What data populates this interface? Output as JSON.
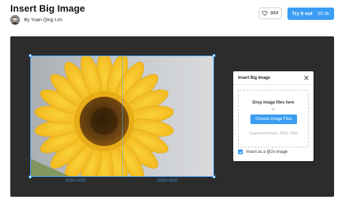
{
  "header": {
    "title": "Insert Big Image",
    "author": "By Yuan Qing Lim",
    "like_count": "884",
    "try_label": "Try it out",
    "try_count": "65.8k"
  },
  "canvas": {
    "dim_left": "3000×4000",
    "dim_right": "3000×4000"
  },
  "dialog": {
    "title": "Insert Big Image",
    "drop_title": "Drop image files here",
    "or_text": "or",
    "choose_label": "Choose Image Files",
    "formats_text": "Supported formats: JPEG, PNG",
    "checkbox_label": "Insert as a @2x image",
    "checkbox_checked": true
  },
  "colors": {
    "accent": "#3a9df1",
    "stage": "#2c2c2c",
    "selection": "#4aa8ff"
  },
  "icons": {
    "like": "heart-icon",
    "close": "close-icon",
    "check": "check-icon"
  }
}
